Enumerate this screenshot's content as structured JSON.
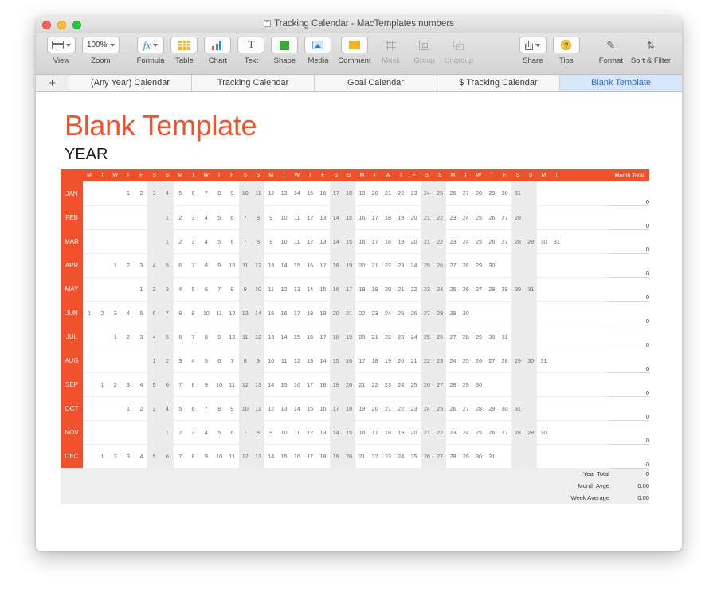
{
  "window": {
    "title": "Tracking Calendar - MacTemplates.numbers",
    "title_icon": "document-icon"
  },
  "toolbar": {
    "left_items": [
      {
        "label": "View",
        "icon": "view-icon",
        "kind": "popup",
        "disabled": false
      },
      {
        "label": "Zoom",
        "icon": "zoom-icon",
        "value": "100%",
        "kind": "popup",
        "disabled": false
      }
    ],
    "insert_items": [
      {
        "label": "Formula",
        "icon": "formula-icon",
        "kind": "popup",
        "disabled": false
      },
      {
        "label": "Table",
        "icon": "table-icon",
        "kind": "button",
        "disabled": false
      },
      {
        "label": "Chart",
        "icon": "chart-icon",
        "kind": "button",
        "disabled": false
      },
      {
        "label": "Text",
        "icon": "text-icon",
        "kind": "button",
        "disabled": false
      },
      {
        "label": "Shape",
        "icon": "shape-icon",
        "kind": "button",
        "disabled": false
      },
      {
        "label": "Media",
        "icon": "media-icon",
        "kind": "button",
        "disabled": false
      },
      {
        "label": "Comment",
        "icon": "comment-icon",
        "kind": "button",
        "disabled": false
      },
      {
        "label": "Mask",
        "icon": "mask-icon",
        "kind": "flat",
        "disabled": true
      },
      {
        "label": "Group",
        "icon": "group-icon",
        "kind": "flat",
        "disabled": true
      },
      {
        "label": "Ungroup",
        "icon": "ungroup-icon",
        "kind": "flat",
        "disabled": true
      }
    ],
    "right_items": [
      {
        "label": "Share",
        "icon": "share-icon",
        "kind": "popup",
        "disabled": false
      },
      {
        "label": "Tips",
        "icon": "tips-icon",
        "glyph": "?",
        "kind": "button",
        "disabled": false
      },
      {
        "label": "Format",
        "icon": "format-icon",
        "glyph": "✎",
        "kind": "flat",
        "disabled": false
      },
      {
        "label": "Sort & Filter",
        "icon": "sort-filter-icon",
        "glyph": "⇅",
        "kind": "flat",
        "disabled": false
      }
    ]
  },
  "tabs": {
    "add_label": "+",
    "items": [
      {
        "label": "(Any Year) Calendar",
        "active": false
      },
      {
        "label": "Tracking Calendar",
        "active": false
      },
      {
        "label": "Goal Calendar",
        "active": false
      },
      {
        "label": "$ Tracking Calendar",
        "active": false
      },
      {
        "label": "Blank Template",
        "active": true
      }
    ]
  },
  "sheet": {
    "title": "Blank Template",
    "subtitle": "YEAR",
    "accent_color": "#f0502a",
    "weekend_color": "#ececec"
  },
  "calendar": {
    "weekday_letters": [
      "M",
      "T",
      "W",
      "T",
      "F",
      "S",
      "S"
    ],
    "weekend_indices": [
      5,
      6
    ],
    "columns": 37,
    "month_total_header": "Month Total",
    "months": [
      {
        "name": "JAN",
        "offset": 3,
        "days": 31,
        "total": "0"
      },
      {
        "name": "FEB",
        "offset": 6,
        "days": 28,
        "total": "0"
      },
      {
        "name": "MAR",
        "offset": 6,
        "days": 31,
        "total": "0"
      },
      {
        "name": "APR",
        "offset": 2,
        "days": 30,
        "total": "0"
      },
      {
        "name": "MAY",
        "offset": 4,
        "days": 31,
        "total": "0"
      },
      {
        "name": "JUN",
        "offset": 0,
        "days": 30,
        "total": "0"
      },
      {
        "name": "JUL",
        "offset": 2,
        "days": 31,
        "total": "0"
      },
      {
        "name": "AUG",
        "offset": 5,
        "days": 31,
        "total": "0"
      },
      {
        "name": "SEP",
        "offset": 1,
        "days": 30,
        "total": "0"
      },
      {
        "name": "OCT",
        "offset": 3,
        "days": 31,
        "total": "0"
      },
      {
        "name": "NOV",
        "offset": 6,
        "days": 30,
        "total": "0"
      },
      {
        "name": "DEC",
        "offset": 1,
        "days": 31,
        "total": "0"
      }
    ],
    "footer": [
      {
        "label": "Year Total",
        "value": "0"
      },
      {
        "label": "Month Avge",
        "value": "0.00"
      },
      {
        "label": "Week Average",
        "value": "0.00"
      }
    ]
  }
}
